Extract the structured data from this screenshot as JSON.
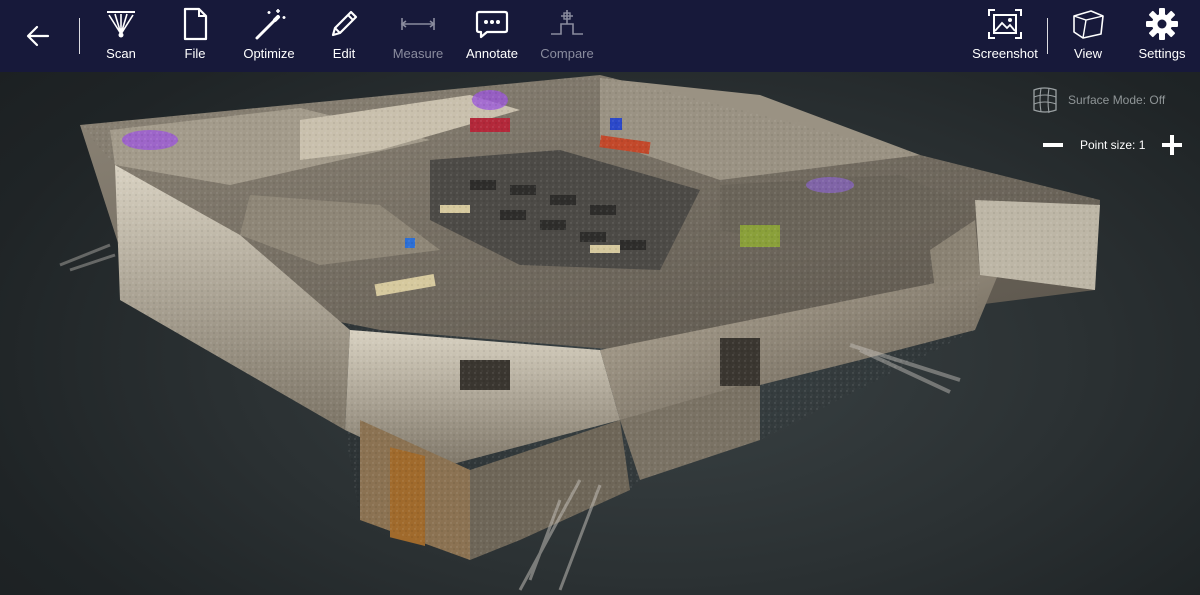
{
  "toolbar": {
    "back_icon": "back-arrow-icon",
    "items": [
      {
        "label": "Scan",
        "icon": "scan-icon",
        "enabled": true
      },
      {
        "label": "File",
        "icon": "file-icon",
        "enabled": true
      },
      {
        "label": "Optimize",
        "icon": "magic-wand-icon",
        "enabled": true
      },
      {
        "label": "Edit",
        "icon": "pencil-icon",
        "enabled": true
      },
      {
        "label": "Measure",
        "icon": "measure-icon",
        "enabled": false
      },
      {
        "label": "Annotate",
        "icon": "speech-bubble-icon",
        "enabled": true
      },
      {
        "label": "Compare",
        "icon": "compare-icon",
        "enabled": false
      },
      {
        "label": "Screenshot",
        "icon": "screenshot-icon",
        "enabled": true
      },
      {
        "label": "View",
        "icon": "cube-icon",
        "enabled": true
      },
      {
        "label": "Settings",
        "icon": "gear-icon",
        "enabled": true
      }
    ],
    "colors": {
      "background": "#17193a",
      "active": "#ffffff",
      "disabled": "#8a8c9e"
    }
  },
  "viewer": {
    "surface_mode_label": "Surface Mode: Off",
    "point_size_label": "Point size: 1",
    "point_size": 1,
    "content": "3D point cloud scan of office floor"
  }
}
